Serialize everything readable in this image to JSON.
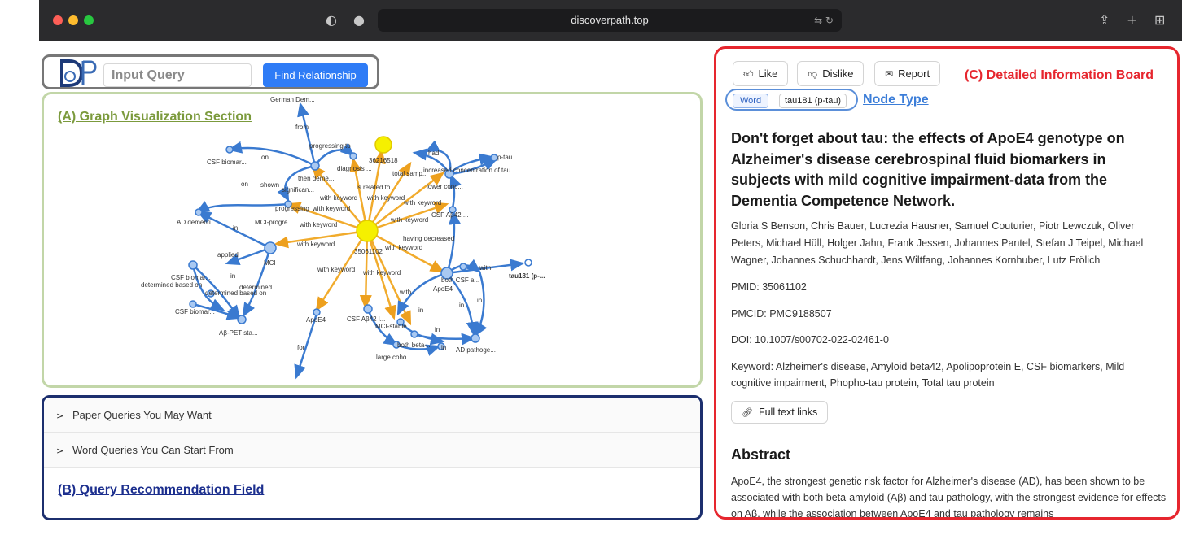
{
  "browser": {
    "url": "discoverpath.top"
  },
  "query_bar": {
    "placeholder": "Input Query",
    "button_label": "Find Relationship"
  },
  "graph_section": {
    "title": "(A) Graph Visualization Section",
    "node_labels": [
      "German Dem...",
      "36216518",
      "p-tau",
      "CSF biomar...",
      "then deme...",
      "diagnosis ...",
      "total samp...",
      "increased concentration of tau",
      "significan...",
      "lower conc...",
      "AD dementi...",
      "MCI-progre...",
      "CSF Aβ42 ...",
      "35061102",
      "MCI",
      "CSF biomar...",
      "CSF biomar...",
      "both CSF a...",
      "tau181 (p-...",
      "ApoE4",
      "ApoE4",
      "Aβ-PET sta...",
      "CSF Aβ42 l...",
      "MCI-stable...",
      "both beta-...",
      "AD pathoge...",
      "large coho..."
    ],
    "edge_labels": [
      "from",
      "progressing to",
      "had",
      "on",
      "shown",
      "is related to",
      "with keyword",
      "with keyword",
      "with keyword",
      "progressing",
      "with keyword",
      "with keyword",
      "with keyword",
      "on",
      "in",
      "applied",
      "with keyword",
      "having decreased",
      "with keyword",
      "with keyword",
      "with keyword",
      "with",
      "in",
      "determined",
      "determined based on",
      "determined based on",
      "with",
      "in",
      "in",
      "in",
      "for",
      "in",
      "in"
    ]
  },
  "reco_section": {
    "items": [
      "Paper Queries You May Want",
      "Word Queries You Can Start From"
    ],
    "title": "(B) Query Recommendation Field"
  },
  "info_board": {
    "like_label": "Like",
    "dislike_label": "Dislike",
    "report_label": "Report",
    "title_label": "(C) Detailed Information Board",
    "tag_type": "Word",
    "tag_value": "tau181 (p-tau)",
    "node_type_label": "Node Type",
    "paper_title": "Don't forget about tau: the effects of ApoE4 genotype on Alzheimer's disease cerebrospinal fluid biomarkers in subjects with mild cognitive impairment-data from the Dementia Competence Network.",
    "authors": "Gloria S Benson, Chris Bauer, Lucrezia Hausner, Samuel Couturier, Piotr Lewczuk, Oliver Peters, Michael Hüll, Holger Jahn, Frank Jessen, Johannes Pantel, Stefan J Teipel, Michael Wagner, Johannes Schuchhardt, Jens Wiltfang, Johannes Kornhuber, Lutz Frölich",
    "pmid": "PMID: 35061102",
    "pmcid": "PMCID: PMC9188507",
    "doi": "DOI: 10.1007/s00702-022-02461-0",
    "keywords": "Keyword: Alzheimer's disease, Amyloid beta42, Apolipoprotein E, CSF biomarkers, Mild cognitive impairment, Phopho-tau protein, Total tau protein",
    "full_text_label": "Full text links",
    "abstract_heading": "Abstract",
    "abstract_text": "ApoE4, the strongest genetic risk factor for Alzheimer's disease (AD), has been shown to be associated with both beta-amyloid (Aβ) and tau pathology, with the strongest evidence for effects on Aβ, while the association between ApoE4 and tau pathology remains"
  }
}
